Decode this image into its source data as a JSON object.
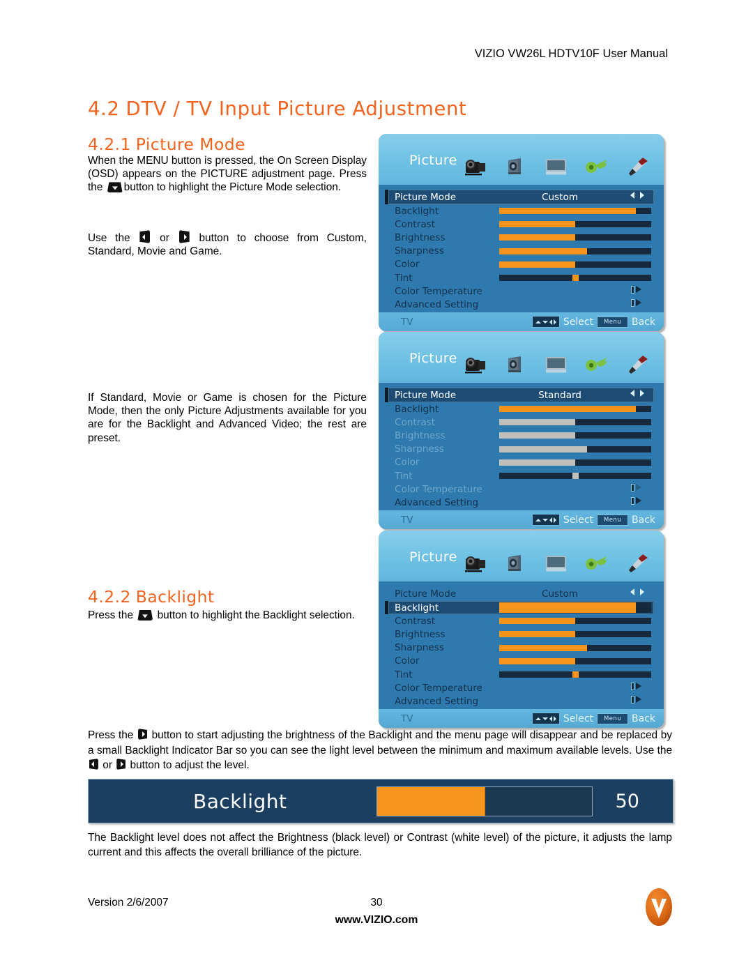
{
  "header": {
    "manual_title": "VIZIO VW26L HDTV10F User Manual"
  },
  "headings": {
    "section_num": "4.2",
    "section_title": "DTV / TV Input Picture Adjustment",
    "sub1_num": "4.2.1",
    "sub1_title": "Picture Mode",
    "sub2_num": "4.2.2",
    "sub2_title": "Backlight"
  },
  "paragraphs": {
    "intro_a": "When the MENU button is pressed, the On Screen Display (OSD) appears on the PICTURE adjustment page.  Press the ",
    "intro_b": "button to highlight the Picture Mode selection.",
    "use_a": "Use the ",
    "use_b": " or ",
    "use_c": " button to choose from Custom, Standard, Movie and Game.",
    "standard_note": "If Standard, Movie or Game is chosen for the Picture Mode, then the only Picture Adjustments available for you are for the Backlight and Advanced Video; the rest are preset.",
    "press_a": "Press the ",
    "press_b": " button to highlight the Backlight selection.",
    "adjust_a": "Press the ",
    "adjust_b": " button to start adjusting the brightness of the Backlight and the menu page will disappear and be replaced by a small Backlight Indicator Bar so you can see the light level between the minimum and maximum available levels.  Use the ",
    "adjust_c": " or ",
    "adjust_d": " button to adjust the level.",
    "note": "The Backlight level does not affect the Brightness (black level) or Contrast (white level) of the picture, it adjusts the lamp current and this affects the overall brilliance of the picture."
  },
  "osd": {
    "title": "Picture",
    "icons": [
      "camcorder-icon",
      "speaker-icon",
      "tv-icon",
      "key-icon",
      "screwdriver-icon"
    ],
    "footer": {
      "source": "TV",
      "select_label": "Select",
      "menu_label": "Menu",
      "back_label": "Back"
    },
    "panels": [
      {
        "id": "custom-mode",
        "mode_label": "Picture Mode",
        "mode_value": "Custom",
        "selected_row": "Picture Mode",
        "rows": [
          {
            "label": "Backlight",
            "value": "90",
            "fill": 90,
            "type": "slider",
            "disabled": false
          },
          {
            "label": "Contrast",
            "value": "50",
            "fill": 50,
            "type": "slider",
            "disabled": false
          },
          {
            "label": "Brightness",
            "value": "50",
            "fill": 50,
            "type": "slider",
            "disabled": false
          },
          {
            "label": "Sharpness",
            "value": "4",
            "fill": 58,
            "type": "slider",
            "disabled": false
          },
          {
            "label": "Color",
            "value": "50",
            "fill": 50,
            "type": "slider",
            "disabled": false
          },
          {
            "label": "Tint",
            "value": "0",
            "fill": 0,
            "knob": 48,
            "type": "knob",
            "disabled": false
          },
          {
            "label": "Color Temperature",
            "value": "",
            "type": "submenu",
            "disabled": false
          },
          {
            "label": "Advanced Setting",
            "value": "",
            "type": "submenu",
            "disabled": false
          }
        ]
      },
      {
        "id": "standard-mode",
        "mode_label": "Picture Mode",
        "mode_value": "Standard",
        "selected_row": "Picture Mode",
        "rows": [
          {
            "label": "Backlight",
            "value": "90",
            "fill": 90,
            "type": "slider",
            "disabled": false
          },
          {
            "label": "Contrast",
            "value": "50",
            "fill": 50,
            "type": "slider",
            "disabled": true
          },
          {
            "label": "Brightness",
            "value": "50",
            "fill": 50,
            "type": "slider",
            "disabled": true
          },
          {
            "label": "Sharpness",
            "value": "4",
            "fill": 58,
            "type": "slider",
            "disabled": true
          },
          {
            "label": "Color",
            "value": "50",
            "fill": 50,
            "type": "slider",
            "disabled": true
          },
          {
            "label": "Tint",
            "value": "0",
            "fill": 0,
            "knob": 48,
            "type": "knob",
            "disabled": true
          },
          {
            "label": "Color Temperature",
            "value": "",
            "type": "submenu",
            "disabled": true
          },
          {
            "label": "Advanced Setting",
            "value": "",
            "type": "submenu",
            "disabled": false
          }
        ]
      },
      {
        "id": "backlight-selected",
        "mode_label": "Picture Mode",
        "mode_value": "Custom",
        "selected_row": "Backlight",
        "rows": [
          {
            "label": "Backlight",
            "value": "90",
            "fill": 90,
            "type": "slider",
            "disabled": false
          },
          {
            "label": "Contrast",
            "value": "50",
            "fill": 50,
            "type": "slider",
            "disabled": false
          },
          {
            "label": "Brightness",
            "value": "50",
            "fill": 50,
            "type": "slider",
            "disabled": false
          },
          {
            "label": "Sharpness",
            "value": "4",
            "fill": 58,
            "type": "slider",
            "disabled": false
          },
          {
            "label": "Color",
            "value": "50",
            "fill": 50,
            "type": "slider",
            "disabled": false
          },
          {
            "label": "Tint",
            "value": "0",
            "fill": 0,
            "knob": 48,
            "type": "knob",
            "disabled": false
          },
          {
            "label": "Color Temperature",
            "value": "",
            "type": "submenu",
            "disabled": false
          },
          {
            "label": "Advanced Setting",
            "value": "",
            "type": "submenu",
            "disabled": false
          }
        ]
      }
    ]
  },
  "backlight_indicator": {
    "label": "Backlight",
    "value": "50",
    "fill_percent": 50
  },
  "footer": {
    "version": "Version 2/6/2007",
    "page_number": "30",
    "website": "www.VIZIO.com",
    "logo": "vizio-logo"
  },
  "colors": {
    "accent_orange": "#F4631E",
    "slider_orange": "#F7941E",
    "osd_header_blue": "#6EC1E4",
    "osd_body_blue": "#2E79AE",
    "osd_selected": "#1C4B74",
    "indicator_bg": "#1C3F60"
  }
}
